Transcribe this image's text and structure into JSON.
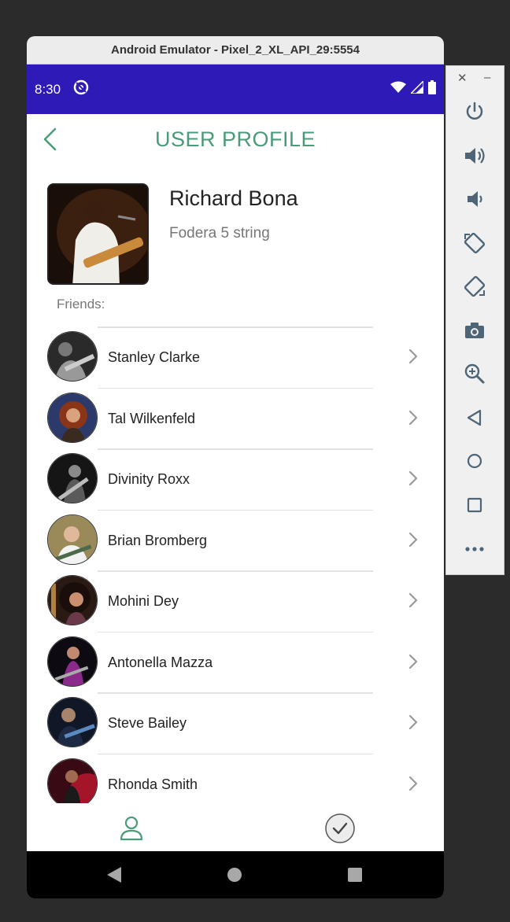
{
  "window": {
    "title": "Android Emulator - Pixel_2_XL_API_29:5554"
  },
  "statusbar": {
    "time": "8:30"
  },
  "appbar": {
    "title": "USER PROFILE"
  },
  "profile": {
    "name": "Richard Bona",
    "subtitle": "Fodera 5 string"
  },
  "friends": {
    "label": "Friends:",
    "items": [
      {
        "name": "Stanley Clarke"
      },
      {
        "name": "Tal Wilkenfeld"
      },
      {
        "name": "Divinity Roxx"
      },
      {
        "name": "Brian Bromberg"
      },
      {
        "name": "Mohini Dey"
      },
      {
        "name": "Antonella Mazza"
      },
      {
        "name": "Steve Bailey"
      },
      {
        "name": "Rhonda Smith"
      }
    ]
  },
  "colors": {
    "status_bar": "#2e1ab7",
    "accent": "#4a9b78"
  },
  "icons": {
    "side_toolbar": [
      "close-icon",
      "minimize-icon",
      "power-icon",
      "volume-up-icon",
      "volume-down-icon",
      "rotate-left-icon",
      "rotate-right-icon",
      "camera-icon",
      "zoom-icon",
      "back-icon",
      "home-icon",
      "overview-icon",
      "more-icon"
    ]
  }
}
